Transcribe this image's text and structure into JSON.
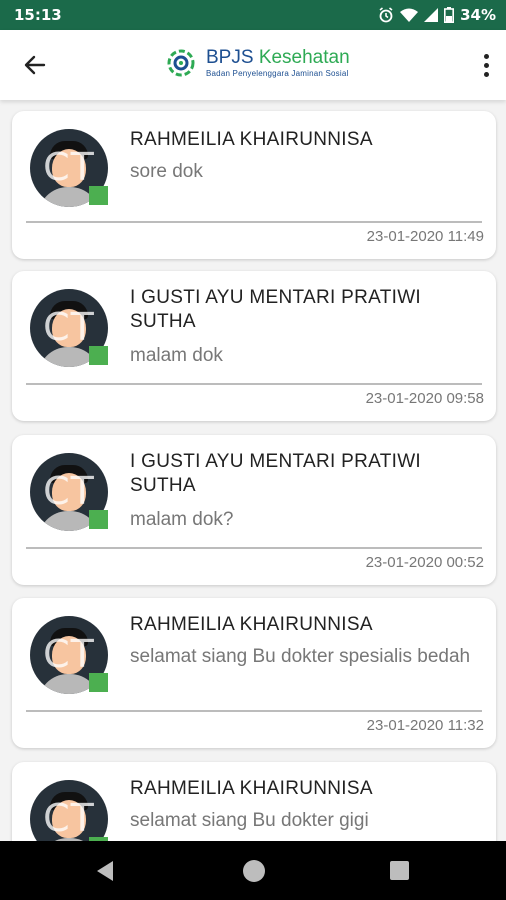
{
  "status_bar": {
    "time": "15:13",
    "battery": "34%"
  },
  "app_bar": {
    "logo_main": "BPJS",
    "logo_kesehatan": "Kesehatan",
    "logo_sub": "Badan Penyelenggara Jaminan Sosial"
  },
  "colors": {
    "status_bar": "#1b6a4a",
    "online": "#4caf50",
    "brand_blue": "#1d4f91",
    "brand_green": "#2eaa54"
  },
  "avatar_initials": "CT",
  "chats": [
    {
      "name": "RAHMEILIA KHAIRUNNISA",
      "message": "sore dok",
      "time": "23-01-2020 11:49"
    },
    {
      "name": "I GUSTI AYU MENTARI PRATIWI SUTHA",
      "message": "malam dok",
      "time": "23-01-2020 09:58"
    },
    {
      "name": "I GUSTI AYU MENTARI PRATIWI SUTHA",
      "message": "malam dok?",
      "time": "23-01-2020 00:52"
    },
    {
      "name": "RAHMEILIA KHAIRUNNISA",
      "message": "selamat siang Bu dokter spesialis bedah",
      "time": "23-01-2020 11:32"
    },
    {
      "name": "RAHMEILIA KHAIRUNNISA",
      "message": "selamat siang Bu dokter gigi",
      "time": ""
    }
  ]
}
